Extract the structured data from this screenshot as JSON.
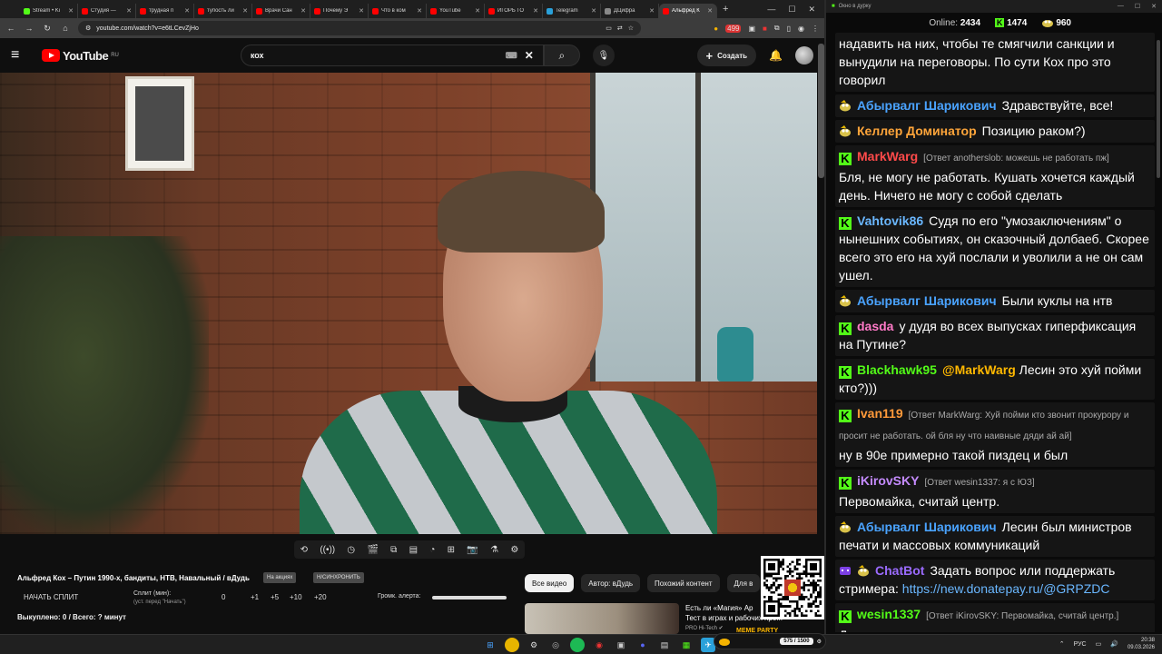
{
  "browser": {
    "tabs": [
      {
        "label": "Stream • Ki",
        "color": "#53fc18"
      },
      {
        "label": "Студия —",
        "color": "#ff0000"
      },
      {
        "label": "трудная п",
        "color": "#ff0000"
      },
      {
        "label": "тупость ли",
        "color": "#ff0000"
      },
      {
        "label": "Врачи Сан",
        "color": "#ff0000"
      },
      {
        "label": "Почему Э",
        "color": "#ff0000"
      },
      {
        "label": "Что в ком",
        "color": "#ff0000"
      },
      {
        "label": "YouTube",
        "color": "#ff0000"
      },
      {
        "label": "ИГОРЬ ГО",
        "color": "#ff0000"
      },
      {
        "label": "Telegram",
        "color": "#2aa1da"
      },
      {
        "label": "ДЦифра",
        "color": "#888888"
      },
      {
        "label": "Альфред К",
        "color": "#ff0000",
        "active": true
      }
    ],
    "url": "youtube.com/watch?v=e6tLCevZjHo",
    "ext_badge": "499"
  },
  "youtube": {
    "logo_text": "YouTube",
    "logo_region": "RU",
    "search_query": "кох",
    "create_label": "Создать",
    "video_title": "Альфред Кох – Путин 1990-х, бандиты, НТВ, Навальный / вДудь",
    "pill_1": "На акциях",
    "pill_2": "Н/СИНХРОНИТЬ",
    "chips": [
      "Все видео",
      "Автор: вДудь",
      "Похожий контент",
      "Для в"
    ],
    "recommendation": {
      "title": "Есть ли «Магия» Ap",
      "subtitle": "Тест в играх и рабочих про...",
      "author": "PRO Hi-Tech ✔"
    }
  },
  "split": {
    "start_label": "НАЧАТЬ СПЛИТ",
    "split_min_label": "Сплит (мин):",
    "split_min_sub": "(уст. перед \"Начать\")",
    "values": [
      "0",
      "+1",
      "+5",
      "+10",
      "+20"
    ],
    "alert_label": "Громк. алерта:",
    "alert_volume": 1.0,
    "paid_line": "Выкуплено: 0 / Всего: ? минут"
  },
  "chat": {
    "window_title": "Окно в дурку",
    "online_label": "Online:",
    "online_count": "2434",
    "kick_count": "1474",
    "yt_count": "960",
    "messages": [
      {
        "platform": "yt",
        "user": "",
        "color": "#fff",
        "reply": "",
        "text": "надавить на них, чтобы те смягчили санкции и вынудили на переговоры. По сути Кох про это говорил",
        "continuation": true
      },
      {
        "platform": "yt",
        "user": "Абырвалг Шарикович",
        "color": "#4aa3ff",
        "reply": "",
        "text": "Здравствуйте, все!"
      },
      {
        "platform": "yt",
        "user": "Келлер Доминатор",
        "color": "#ffa53a",
        "reply": "",
        "text": "Позицию раком?)"
      },
      {
        "platform": "kick",
        "user": "MarkWarg",
        "color": "#ff4a4a",
        "reply": "[Ответ anotherslob: можешь не работать пж]",
        "text": "Бля, не могу не работать. Кушать хочется каждый день. Ничего не могу с собой сделать"
      },
      {
        "platform": "kick",
        "user": "Vahtovik86",
        "color": "#6ab7ff",
        "reply": "",
        "text": "Судя по его \"умозаключениям\" о нынешних событиях, он сказочный долбаеб. Скорее всего это его на хуй послали и уволили а не он сам ушел."
      },
      {
        "platform": "yt",
        "user": "Абырвалг Шарикович",
        "color": "#4aa3ff",
        "reply": "",
        "text": "Были куклы на нтв"
      },
      {
        "platform": "kick",
        "user": "dasda",
        "color": "#ff7ac8",
        "reply": "",
        "text": "у дудя во всех выпусках гиперфиксация на Путине?"
      },
      {
        "platform": "kick",
        "user": "Blackhawk95",
        "color": "#53fc18",
        "reply": "",
        "mention": "@MarkWarg",
        "text": "Лесин это хуй пойми кто?)))"
      },
      {
        "platform": "kick",
        "user": "Ivan119",
        "color": "#ff9a3a",
        "reply": "[Ответ MarkWarg: Хуй пойми кто звонит прокурору и просит не работать. ой бля ну что наивные дяди ай ай]",
        "text": "ну в 90е примерно такой пиздец и был"
      },
      {
        "platform": "kick",
        "user": "iKirovSKY",
        "color": "#c58bff",
        "reply": "[Ответ wesin1337: я с ЮЗ]",
        "text": "Первомайка, считай центр."
      },
      {
        "platform": "yt",
        "user": "Абырвалг Шарикович",
        "color": "#4aa3ff",
        "reply": "",
        "text": "Лесин был министров печати и  массовых коммуникаций"
      },
      {
        "platform": "bot",
        "user": "ChatBot",
        "color": "#9b6bff",
        "reply": "",
        "text": "Задать вопрос или поддержать стримера:",
        "link": "https://new.donatepay.ru/@GRPZDC"
      },
      {
        "platform": "kick",
        "user": "wesin1337",
        "color": "#53fc18",
        "reply": "[Ответ iKirovSKY: Первомайка, считай центр.]",
        "text": "Дарою тогда"
      }
    ]
  },
  "memeparty": {
    "title": "MEME PARTY",
    "progress_text": "575 / 1500",
    "progress": 0.383
  },
  "taskbar": {
    "lang": "РУС",
    "time": "20:38",
    "date": "09.03.2026"
  },
  "colors": {
    "kick_green": "#53fc18",
    "youtube_red": "#ff0000",
    "bg": "#0f0f0f"
  }
}
